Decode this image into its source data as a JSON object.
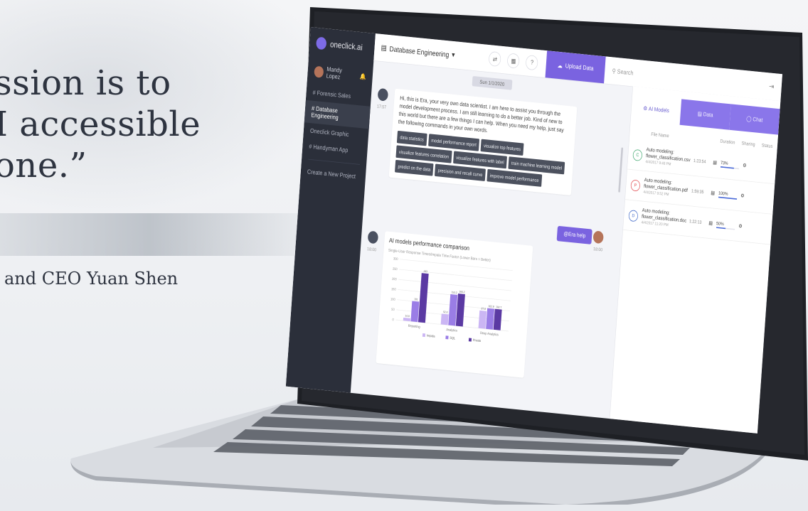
{
  "quote": {
    "line1": "ssion is to",
    "line2": "I accessible",
    "line3": "one.”",
    "attribution": "and CEO Yuan Shen"
  },
  "app": {
    "logo_text": "oneclick.ai",
    "user_name": "Mandy Lopez",
    "sidebar_items": [
      {
        "label": "# Forensic Sales"
      },
      {
        "label": "# Database Engineering"
      },
      {
        "label": "Oneclick Graphic"
      },
      {
        "label": "# Handyman App"
      }
    ],
    "create_project": "Create a New Project",
    "project_title": "Database Engineering",
    "upload_label": "Upload Data",
    "search_placeholder": "Search",
    "date_chip": "Sun 1/1/2020",
    "bot_message": "Hi, this is Era, your very own data scientist. I am here to assist you through the model development process. I am still learning to do a better job. Kind of new to this world but there are a few things I can help. When you need my help, just say the following commands in your own words.",
    "bot_time": "17:57",
    "chips": [
      "data statistics",
      "model performance report",
      "visualize top features",
      "visualize features correlation",
      "visualize features with label",
      "train machine learning model",
      "predict on the data",
      "precision and recall curve",
      "improve model performance"
    ],
    "help_button": "@Era help",
    "help_time": "18:00",
    "chart_time": "18:00",
    "chart_card_title": "AI models performance comparison",
    "chart_card_subtitle": "Single-User Response Times/Impala Time Factor (Lower Bars = Better)",
    "right_tabs": [
      {
        "label": "AI Models"
      },
      {
        "label": "Data"
      },
      {
        "label": "Chat"
      }
    ],
    "right_headers": [
      "File Name",
      "Duration",
      "Sharing",
      "Status"
    ],
    "files": [
      {
        "title": "Auto modeling:",
        "name": "flower_classification.csv",
        "date": "4/4/2017 9:48 PM",
        "duration": "1:23:54",
        "pct": "73%",
        "color": "#3aa56b",
        "icon": "csv"
      },
      {
        "title": "Auto modeling:",
        "name": "flower_classification.pdf",
        "date": "4/4/2017 9:52 PM",
        "duration": "1:59:35",
        "pct": "100%",
        "color": "#e0454b",
        "icon": "pdf"
      },
      {
        "title": "Auto modeling:",
        "name": "flower_classification.doc",
        "date": "4/4/2017 11:20 PM",
        "duration": "1:22:13",
        "pct": "50%",
        "color": "#3f68c8",
        "icon": "doc"
      }
    ],
    "file_progress": [
      0.73,
      1.0,
      0.5
    ]
  },
  "chart_data": {
    "type": "bar",
    "categories": [
      "Reporting",
      "Analytics",
      "Deep Analytics"
    ],
    "series": [
      {
        "name": "Impala",
        "values": [
          14.8,
          52.8,
          87.8
        ]
      },
      {
        "name": "SQL",
        "values": [
          101,
          153.2,
          102.9
        ]
      },
      {
        "name": "Presto",
        "values": [
          243,
          160.2,
          102.7
        ]
      }
    ],
    "colors": [
      "#cbb6f4",
      "#9a7de6",
      "#5b3aa3"
    ],
    "ylim": [
      0,
      300
    ]
  }
}
